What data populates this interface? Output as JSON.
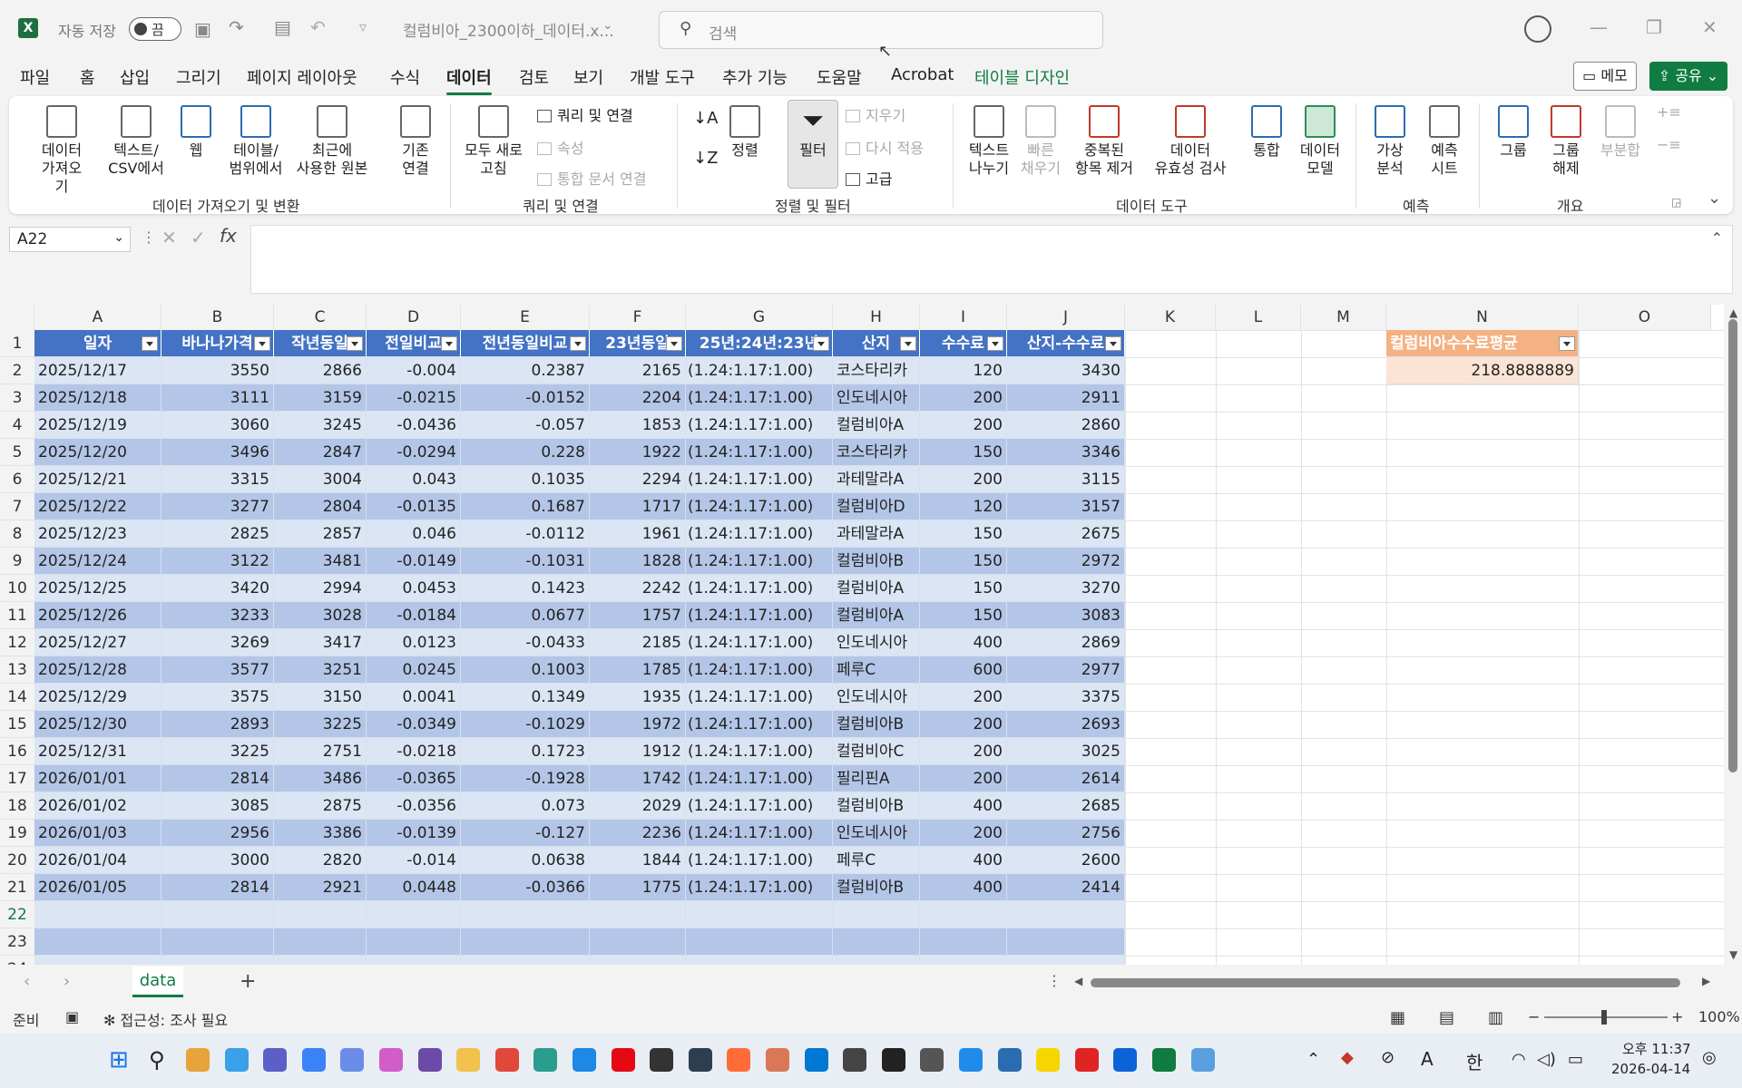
{
  "titlebar": {
    "autosave_label": "자동 저장",
    "autosave_state": "끔",
    "filename": "컬럼비아_2300이하_데이터.x...",
    "search_placeholder": "검색",
    "app_icon": "X"
  },
  "menu": {
    "items": [
      "파일",
      "홈",
      "삽입",
      "그리기",
      "페이지 레이아웃",
      "수식",
      "데이터",
      "검토",
      "보기",
      "개발 도구",
      "추가 기능",
      "도움말",
      "Acrobat",
      "테이블 디자인"
    ],
    "active": "데이터",
    "memo": "메모",
    "share": "공유"
  },
  "ribbon": {
    "get_data": "데이터\n가져오기",
    "text_csv": "텍스트/\nCSV에서",
    "web": "웹",
    "table_range": "테이블/\n범위에서",
    "recent_sources": "최근에\n사용한 원본",
    "existing_conn": "기존\n연결",
    "group1": "데이터 가져오기 및 변환",
    "refresh_all": "모두 새로\n고침",
    "queries_conn": "쿼리 및 연결",
    "properties": "속성",
    "edit_links": "통합 문서 연결",
    "group2": "쿼리 및 연결",
    "sort": "정렬",
    "filter": "필터",
    "clear": "지우기",
    "reapply": "다시 적용",
    "advanced": "고급",
    "group3": "정렬 및 필터",
    "text_to_cols": "텍스트\n나누기",
    "flash_fill": "빠른\n채우기",
    "remove_dup": "중복된\n항목 제거",
    "validation": "데이터\n유효성 검사",
    "consolidate": "통합",
    "data_model": "데이터\n모델",
    "group4": "데이터 도구",
    "whatif": "가상\n분석",
    "forecast_sheet": "예측\n시트",
    "group5": "예측",
    "group_btn": "그룹",
    "ungroup": "그룹\n해제",
    "subtotal": "부분합",
    "group6": "개요"
  },
  "formula": {
    "namebox": "A22",
    "content": ""
  },
  "grid": {
    "columns": [
      "A",
      "B",
      "C",
      "D",
      "E",
      "F",
      "G",
      "H",
      "I",
      "J",
      "K",
      "L",
      "M",
      "N",
      "O"
    ],
    "headers": [
      "일자",
      "바나나가격",
      "작년동일",
      "전일비교",
      "전년동일비교",
      "23년동일",
      "25년:24년:23년",
      "산지",
      "수수료",
      "산지-수수료"
    ],
    "rows": [
      [
        "2025/12/17",
        "3550",
        "2866",
        "-0.004",
        "0.2387",
        "2165",
        "(1.24:1.17:1.00)",
        "코스타리카",
        "120",
        "3430"
      ],
      [
        "2025/12/18",
        "3111",
        "3159",
        "-0.0215",
        "-0.0152",
        "2204",
        "(1.24:1.17:1.00)",
        "인도네시아",
        "200",
        "2911"
      ],
      [
        "2025/12/19",
        "3060",
        "3245",
        "-0.0436",
        "-0.057",
        "1853",
        "(1.24:1.17:1.00)",
        "컬럼비아A",
        "200",
        "2860"
      ],
      [
        "2025/12/20",
        "3496",
        "2847",
        "-0.0294",
        "0.228",
        "1922",
        "(1.24:1.17:1.00)",
        "코스타리카",
        "150",
        "3346"
      ],
      [
        "2025/12/21",
        "3315",
        "3004",
        "0.043",
        "0.1035",
        "2294",
        "(1.24:1.17:1.00)",
        "과테말라A",
        "200",
        "3115"
      ],
      [
        "2025/12/22",
        "3277",
        "2804",
        "-0.0135",
        "0.1687",
        "1717",
        "(1.24:1.17:1.00)",
        "컬럼비아D",
        "120",
        "3157"
      ],
      [
        "2025/12/23",
        "2825",
        "2857",
        "0.046",
        "-0.0112",
        "1961",
        "(1.24:1.17:1.00)",
        "과테말라A",
        "150",
        "2675"
      ],
      [
        "2025/12/24",
        "3122",
        "3481",
        "-0.0149",
        "-0.1031",
        "1828",
        "(1.24:1.17:1.00)",
        "컬럼비아B",
        "150",
        "2972"
      ],
      [
        "2025/12/25",
        "3420",
        "2994",
        "0.0453",
        "0.1423",
        "2242",
        "(1.24:1.17:1.00)",
        "컬럼비아A",
        "150",
        "3270"
      ],
      [
        "2025/12/26",
        "3233",
        "3028",
        "-0.0184",
        "0.0677",
        "1757",
        "(1.24:1.17:1.00)",
        "컬럼비아A",
        "150",
        "3083"
      ],
      [
        "2025/12/27",
        "3269",
        "3417",
        "0.0123",
        "-0.0433",
        "2185",
        "(1.24:1.17:1.00)",
        "인도네시아",
        "400",
        "2869"
      ],
      [
        "2025/12/28",
        "3577",
        "3251",
        "0.0245",
        "0.1003",
        "1785",
        "(1.24:1.17:1.00)",
        "페루C",
        "600",
        "2977"
      ],
      [
        "2025/12/29",
        "3575",
        "3150",
        "0.0041",
        "0.1349",
        "1935",
        "(1.24:1.17:1.00)",
        "인도네시아",
        "200",
        "3375"
      ],
      [
        "2025/12/30",
        "2893",
        "3225",
        "-0.0349",
        "-0.1029",
        "1972",
        "(1.24:1.17:1.00)",
        "컬럼비아B",
        "200",
        "2693"
      ],
      [
        "2025/12/31",
        "3225",
        "2751",
        "-0.0218",
        "0.1723",
        "1912",
        "(1.24:1.17:1.00)",
        "컬럼비아C",
        "200",
        "3025"
      ],
      [
        "2026/01/01",
        "2814",
        "3486",
        "-0.0365",
        "-0.1928",
        "1742",
        "(1.24:1.17:1.00)",
        "필리핀A",
        "200",
        "2614"
      ],
      [
        "2026/01/02",
        "3085",
        "2875",
        "-0.0356",
        "0.073",
        "2029",
        "(1.24:1.17:1.00)",
        "컬럼비아B",
        "400",
        "2685"
      ],
      [
        "2026/01/03",
        "2956",
        "3386",
        "-0.0139",
        "-0.127",
        "2236",
        "(1.24:1.17:1.00)",
        "인도네시아",
        "200",
        "2756"
      ],
      [
        "2026/01/04",
        "3000",
        "2820",
        "-0.014",
        "0.0638",
        "1844",
        "(1.24:1.17:1.00)",
        "페루C",
        "400",
        "2600"
      ],
      [
        "2026/01/05",
        "2814",
        "2921",
        "0.0448",
        "-0.0366",
        "1775",
        "(1.24:1.17:1.00)",
        "컬럼비아B",
        "400",
        "2414"
      ]
    ],
    "side_header": "컬럼비아수수료평균",
    "side_value": "218.8888889"
  },
  "sheet_tab": "data",
  "status": {
    "ready": "준비",
    "accessibility": "접근성: 조사 필요",
    "zoom": "100%"
  },
  "taskbar": {
    "time": "오후 11:37",
    "date": "2026-04-14",
    "ime": "한",
    "ime2": "A"
  },
  "colors": {
    "accent": "#107c41",
    "table_header": "#4472c4",
    "band_light": "#dbe5f4",
    "band_dark": "#b4c6e7",
    "side_header": "#f4b183",
    "side_value_bg": "#fbe4d5"
  }
}
